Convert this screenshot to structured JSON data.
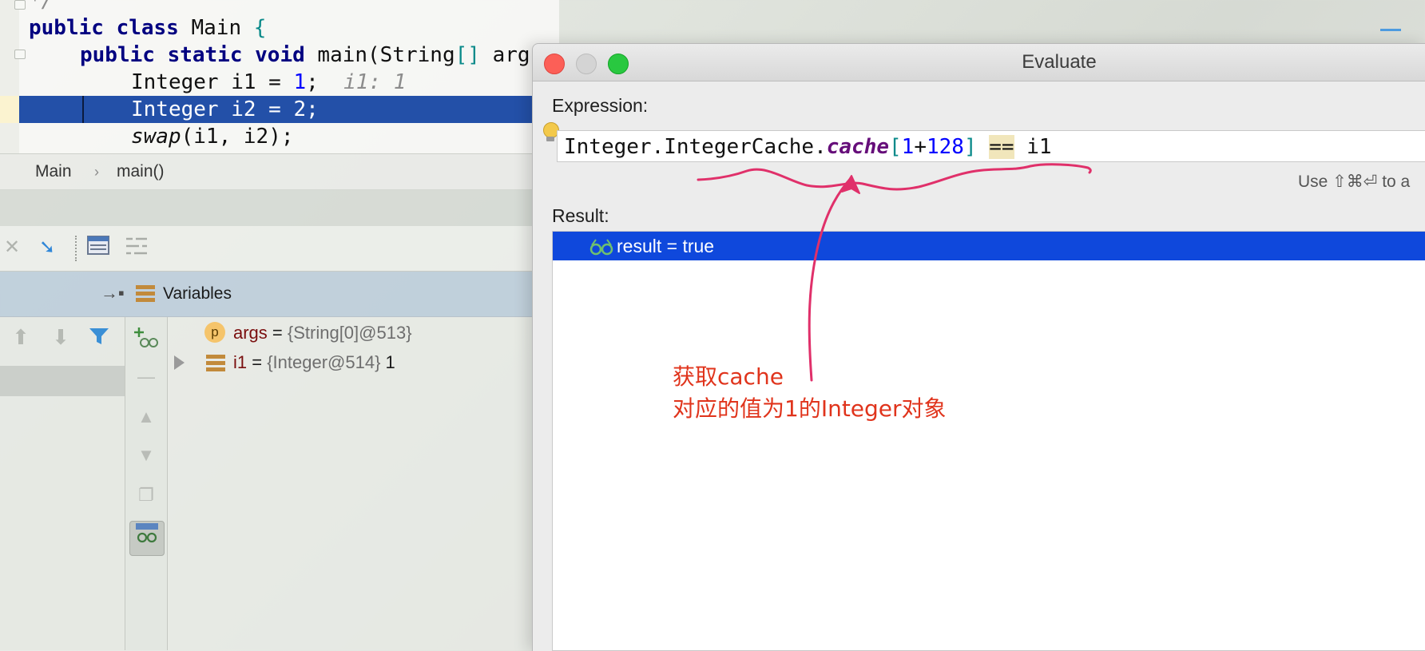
{
  "editor": {
    "line0": "*/",
    "line1_kw": "public class",
    "line1_rest": " Main ",
    "line1_brace": "{",
    "line2_kw": "public static void",
    "line2_rest": " main(String",
    "line2_br": "[]",
    "line2_tail": " arg",
    "line3_a": "Integer i1 = ",
    "line3_num": "1",
    "line3_b": ";  ",
    "line3_hint": "i1: 1",
    "line4": "Integer i2 = 2;",
    "line5_fn": "swap",
    "line5_rest": "(i1, i2);"
  },
  "breadcrumb": {
    "items": [
      "Main",
      "main()"
    ],
    "separator": "›"
  },
  "toolbar": {
    "icons": [
      "frames-disabled-icon",
      "step-into-cursor-icon",
      "evaluate-table-icon",
      "trace-icon"
    ]
  },
  "variables": {
    "title": "Variables",
    "rows": [
      {
        "badge": "p",
        "name": "args",
        "eq": " = ",
        "value": "{String[0]@513}",
        "extra": ""
      },
      {
        "badge": "",
        "name": "i1",
        "eq": " = ",
        "value": "{Integer@514}",
        "extra": " 1"
      }
    ]
  },
  "dialog": {
    "title": "Evaluate",
    "expression_label": "Expression:",
    "expression": {
      "prefix": "Integer.IntegerCache.",
      "field": "cache",
      "open": "[",
      "n1": "1",
      "plus": "+",
      "n2": "128",
      "close": "]",
      "space": " ",
      "op": "==",
      "suffix": " i1"
    },
    "shortcut_hint": "Use ⇧⌘⏎ to a",
    "result_label": "Result:",
    "result": "result = true"
  },
  "annotation": {
    "text": "获取cache\n对应的值为1的Integer对象",
    "color": "#e0341c"
  },
  "colors": {
    "selection": "#0f48dc",
    "editor_selection": "#2350a8",
    "keyword": "#000080",
    "number": "#0000ff",
    "field": "#660e7a"
  }
}
